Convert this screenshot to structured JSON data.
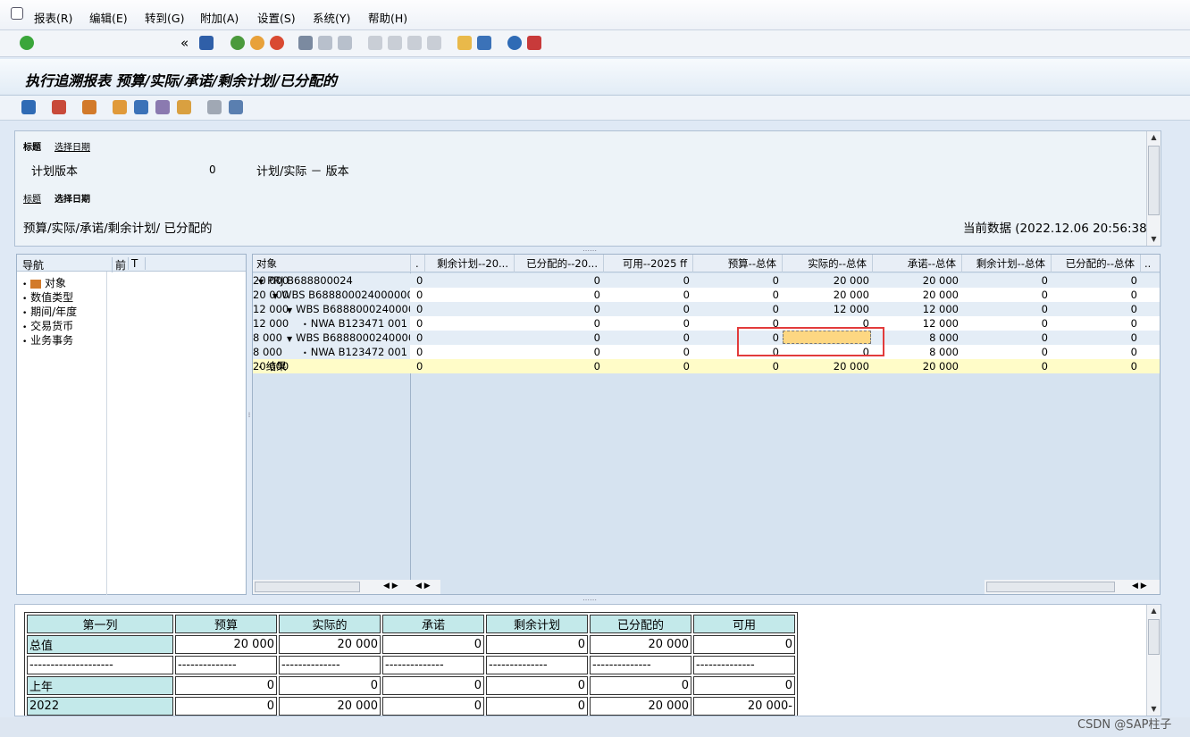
{
  "menu": [
    "报表(R)",
    "编辑(E)",
    "转到(G)",
    "附加(A)",
    "设置(S)",
    "系统(Y)",
    "帮助(H)"
  ],
  "toolbar": {
    "back_chevron": "«"
  },
  "title": "执行追溯报表 预算/实际/承诺/剩余计划/已分配的",
  "header": {
    "tab1": "标题",
    "tab2": "选择日期",
    "plan_version_label": "计划版本",
    "plan_version_value": "0",
    "plan_version_desc": "计划/实际 － 版本",
    "tab1b": "标题",
    "tab2b": "选择日期",
    "report_desc": "预算/实际/承诺/剩余计划/ 已分配的",
    "current_data": "当前数据 (2022.12.06 20:56:38)"
  },
  "nav": {
    "header": "导航",
    "col2": "前",
    "col3": "T",
    "items": [
      "对象",
      "数值类型",
      "期间/年度",
      "交易货币",
      "业务事务"
    ]
  },
  "grid": {
    "columns": [
      "对象",
      ".",
      "剩余计划--20...",
      "已分配的--20...",
      "可用--2025 ff",
      "预算--总体",
      "实际的--总体",
      "承诺--总体",
      "剩余计划--总体",
      "已分配的--总体",
      ".."
    ],
    "rows": [
      {
        "obj": "PRJ B688800024",
        "c": [
          "0",
          "0",
          "0",
          "0",
          "20 000",
          "20 000",
          "0",
          "0",
          "20 000"
        ]
      },
      {
        "obj": "WBS B688800024000000",
        "c": [
          "0",
          "0",
          "0",
          "0",
          "20 000",
          "20 000",
          "0",
          "0",
          "20 000"
        ]
      },
      {
        "obj": "WBS B6888000240000",
        "c": [
          "0",
          "0",
          "0",
          "0",
          "12 000",
          "12 000",
          "0",
          "0",
          "12 000"
        ]
      },
      {
        "obj": "NWA B123471 001",
        "c": [
          "0",
          "0",
          "0",
          "0",
          "0",
          "12 000",
          "0",
          "0",
          "12 000"
        ]
      },
      {
        "obj": "WBS B6888000240000",
        "c": [
          "0",
          "0",
          "0",
          "0",
          "8 000",
          "8 000",
          "0",
          "0",
          "8 000"
        ]
      },
      {
        "obj": "NWA B123472 001",
        "c": [
          "0",
          "0",
          "0",
          "0",
          "0",
          "8 000",
          "0",
          "0",
          "8 000"
        ]
      },
      {
        "obj": "结果",
        "c": [
          "0",
          "0",
          "0",
          "0",
          "20 000",
          "20 000",
          "0",
          "0",
          "20 000"
        ]
      }
    ]
  },
  "bottom": {
    "headers": [
      "第一列",
      "预算",
      "实际的",
      "承诺",
      "剩余计划",
      "已分配的",
      "可用"
    ],
    "rows": [
      {
        "label": "总值",
        "v": [
          "20 000",
          "20 000",
          "0",
          "0",
          "20 000",
          "0"
        ]
      },
      {
        "label": "--------------------",
        "v": [
          "--------------",
          "--------------",
          "--------------",
          "--------------",
          "--------------",
          "--------------"
        ]
      },
      {
        "label": "上年",
        "v": [
          "0",
          "0",
          "0",
          "0",
          "0",
          "0"
        ]
      },
      {
        "label": "2022",
        "v": [
          "0",
          "20 000",
          "0",
          "0",
          "20 000",
          "20 000-"
        ]
      }
    ]
  },
  "watermark": "CSDN @SAP柱子",
  "colors": {
    "highlight_red": "#e23b3b",
    "selected_cell": "#fdd782",
    "total_row": "#fffcc8",
    "bottom_header": "#c3e9ea"
  }
}
